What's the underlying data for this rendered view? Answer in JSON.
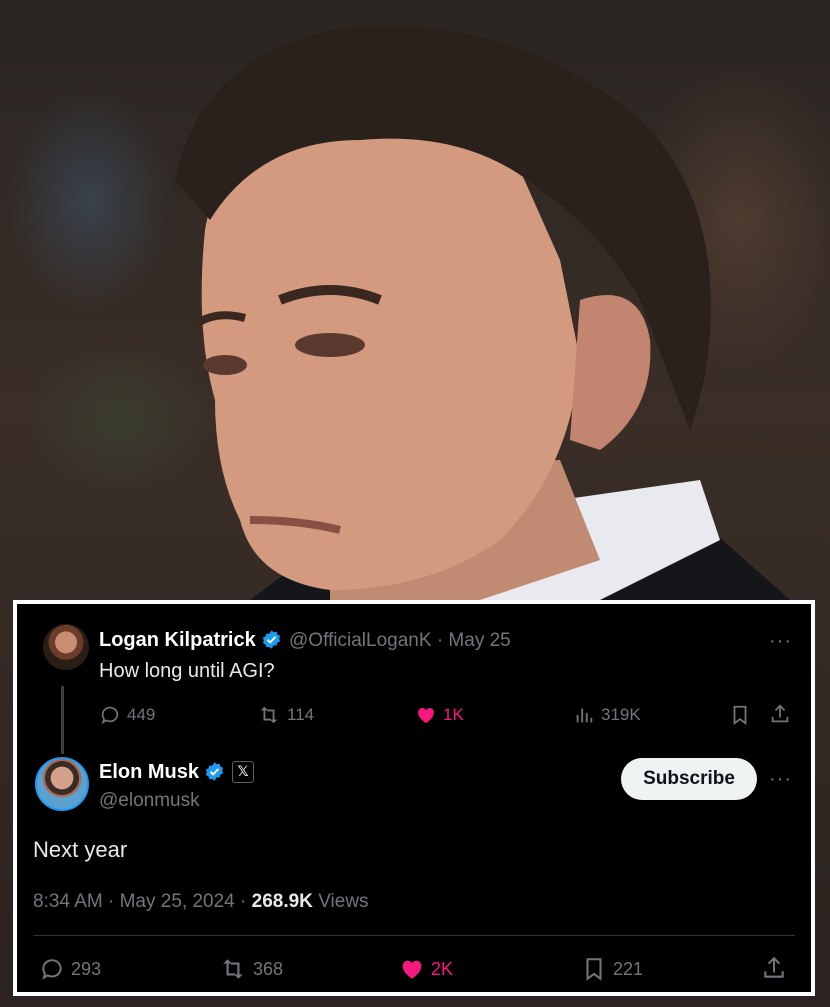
{
  "reply_tweet": {
    "author_name": "Logan Kilpatrick",
    "handle": "@OfficialLoganK",
    "separator": "·",
    "date": "May 25",
    "text": "How long until AGI?",
    "stats": {
      "replies": "449",
      "reposts": "114",
      "likes": "1K",
      "views": "319K"
    }
  },
  "main_tweet": {
    "author_name": "Elon Musk",
    "handle": "@elonmusk",
    "affiliate_badge": "𝕏",
    "subscribe_label": "Subscribe",
    "text": "Next year",
    "time": "8:34 AM",
    "date": "May 25, 2024",
    "views_count": "268.9K",
    "views_label": "Views",
    "stats": {
      "replies": "293",
      "reposts": "368",
      "likes": "2K",
      "bookmarks": "221"
    }
  },
  "icons": {
    "verified": "verified-badge-icon",
    "reply": "reply-icon",
    "repost": "repost-icon",
    "like": "heart-icon",
    "views": "bar-chart-icon",
    "bookmark": "bookmark-icon",
    "share": "share-icon",
    "more": "more-dots-icon"
  },
  "colors": {
    "background": "#000000",
    "text": "#e7e9ea",
    "muted": "#71767b",
    "verified_blue": "#1d9bf0",
    "like_pink": "#f91880",
    "border": "#ffffff"
  }
}
